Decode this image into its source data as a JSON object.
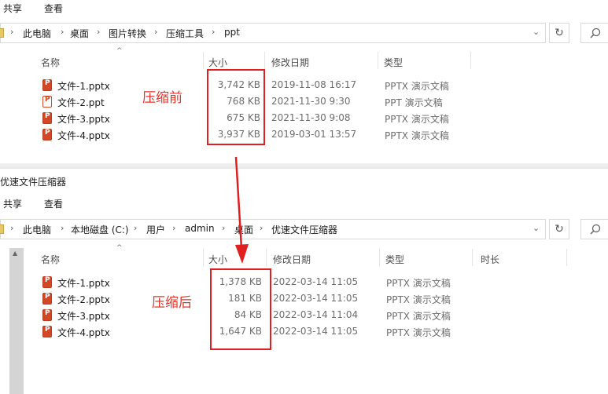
{
  "top": {
    "ribbon": {
      "share": "共享",
      "view": "查看"
    },
    "breadcrumb": [
      "此电脑",
      "桌面",
      "图片转换",
      "压缩工具",
      "ppt"
    ],
    "columns": {
      "name": "名称",
      "size": "大小",
      "modified": "修改日期",
      "type": "类型"
    },
    "files": [
      {
        "name": "文件-1.pptx",
        "size": "3,742 KB",
        "date": "2019-11-08 16:17",
        "type": "PPTX 演示文稿",
        "icon": "pptx-file-icon"
      },
      {
        "name": "文件-2.ppt",
        "size": "768 KB",
        "date": "2021-11-30 9:30",
        "type": "PPT 演示文稿",
        "icon": "ppt-file-icon"
      },
      {
        "name": "文件-3.pptx",
        "size": "675 KB",
        "date": "2021-11-30 9:08",
        "type": "PPTX 演示文稿",
        "icon": "pptx-file-icon"
      },
      {
        "name": "文件-4.pptx",
        "size": "3,937 KB",
        "date": "2019-03-01 13:57",
        "type": "PPTX 演示文稿",
        "icon": "pptx-file-icon"
      }
    ],
    "annotation": "压缩前"
  },
  "bottom": {
    "window_title": "优速文件压缩器",
    "ribbon": {
      "share": "共享",
      "view": "查看"
    },
    "breadcrumb": [
      "此电脑",
      "本地磁盘 (C:)",
      "用户",
      "admin",
      "桌面",
      "优速文件压缩器"
    ],
    "columns": {
      "name": "名称",
      "size": "大小",
      "modified": "修改日期",
      "type": "类型",
      "duration": "时长"
    },
    "files": [
      {
        "name": "文件-1.pptx",
        "size": "1,378 KB",
        "date": "2022-03-14 11:05",
        "type": "PPTX 演示文稿",
        "icon": "pptx-file-icon"
      },
      {
        "name": "文件-2.pptx",
        "size": "181 KB",
        "date": "2022-03-14 11:05",
        "type": "PPTX 演示文稿",
        "icon": "pptx-file-icon"
      },
      {
        "name": "文件-3.pptx",
        "size": "84 KB",
        "date": "2022-03-14 11:04",
        "type": "PPTX 演示文稿",
        "icon": "pptx-file-icon"
      },
      {
        "name": "文件-4.pptx",
        "size": "1,647 KB",
        "date": "2022-03-14 11:05",
        "type": "PPTX 演示文稿",
        "icon": "pptx-file-icon"
      }
    ],
    "annotation": "压缩后"
  },
  "colors": {
    "highlight": "#e02020",
    "annotation": "#e5332a",
    "pptx_icon": "#d24726"
  }
}
